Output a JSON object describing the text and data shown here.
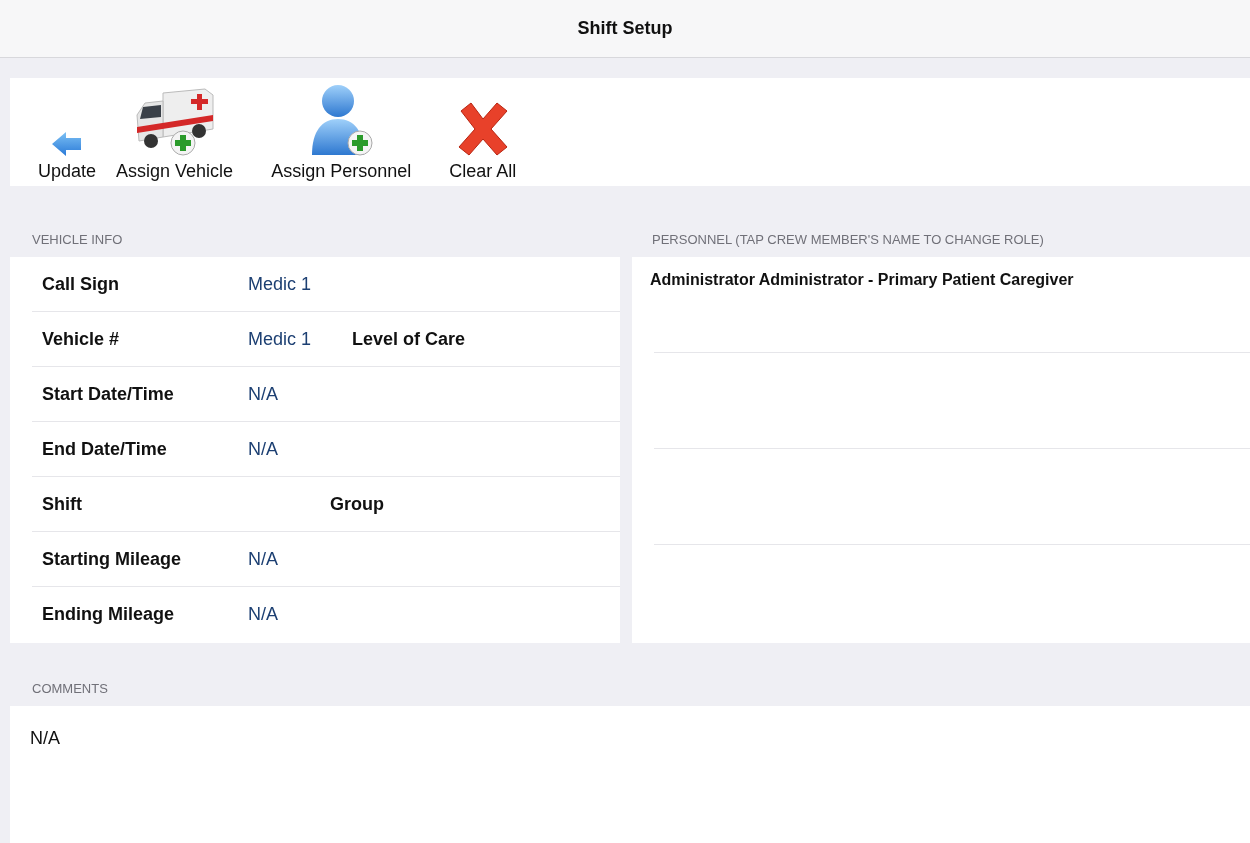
{
  "window": {
    "title": "Shift Setup"
  },
  "toolbar": [
    {
      "kind": "back",
      "label": "Update"
    },
    {
      "kind": "vehicle",
      "label": "Assign Vehicle"
    },
    {
      "kind": "person",
      "label": "Assign Personnel"
    },
    {
      "kind": "clear",
      "label": "Clear All"
    }
  ],
  "vehicle_info": {
    "heading": "VEHICLE INFO",
    "rows": [
      {
        "label": "Call Sign",
        "value": "Medic 1"
      },
      {
        "label": "Vehicle #",
        "value": "Medic 1",
        "extra": "Level of Care"
      },
      {
        "label": "Start Date/Time",
        "value": "N/A"
      },
      {
        "label": "End Date/Time",
        "value": "N/A"
      },
      {
        "label": "Shift",
        "extra": "Group"
      },
      {
        "label": "Starting Mileage",
        "value": "N/A"
      },
      {
        "label": "Ending Mileage",
        "value": "N/A"
      }
    ]
  },
  "personnel": {
    "heading": "PERSONNEL (TAP CREW MEMBER'S NAME TO CHANGE ROLE)",
    "members": [
      "Administrator Administrator - Primary Patient Caregiver"
    ]
  },
  "comments": {
    "heading": "COMMENTS",
    "value": "N/A"
  }
}
